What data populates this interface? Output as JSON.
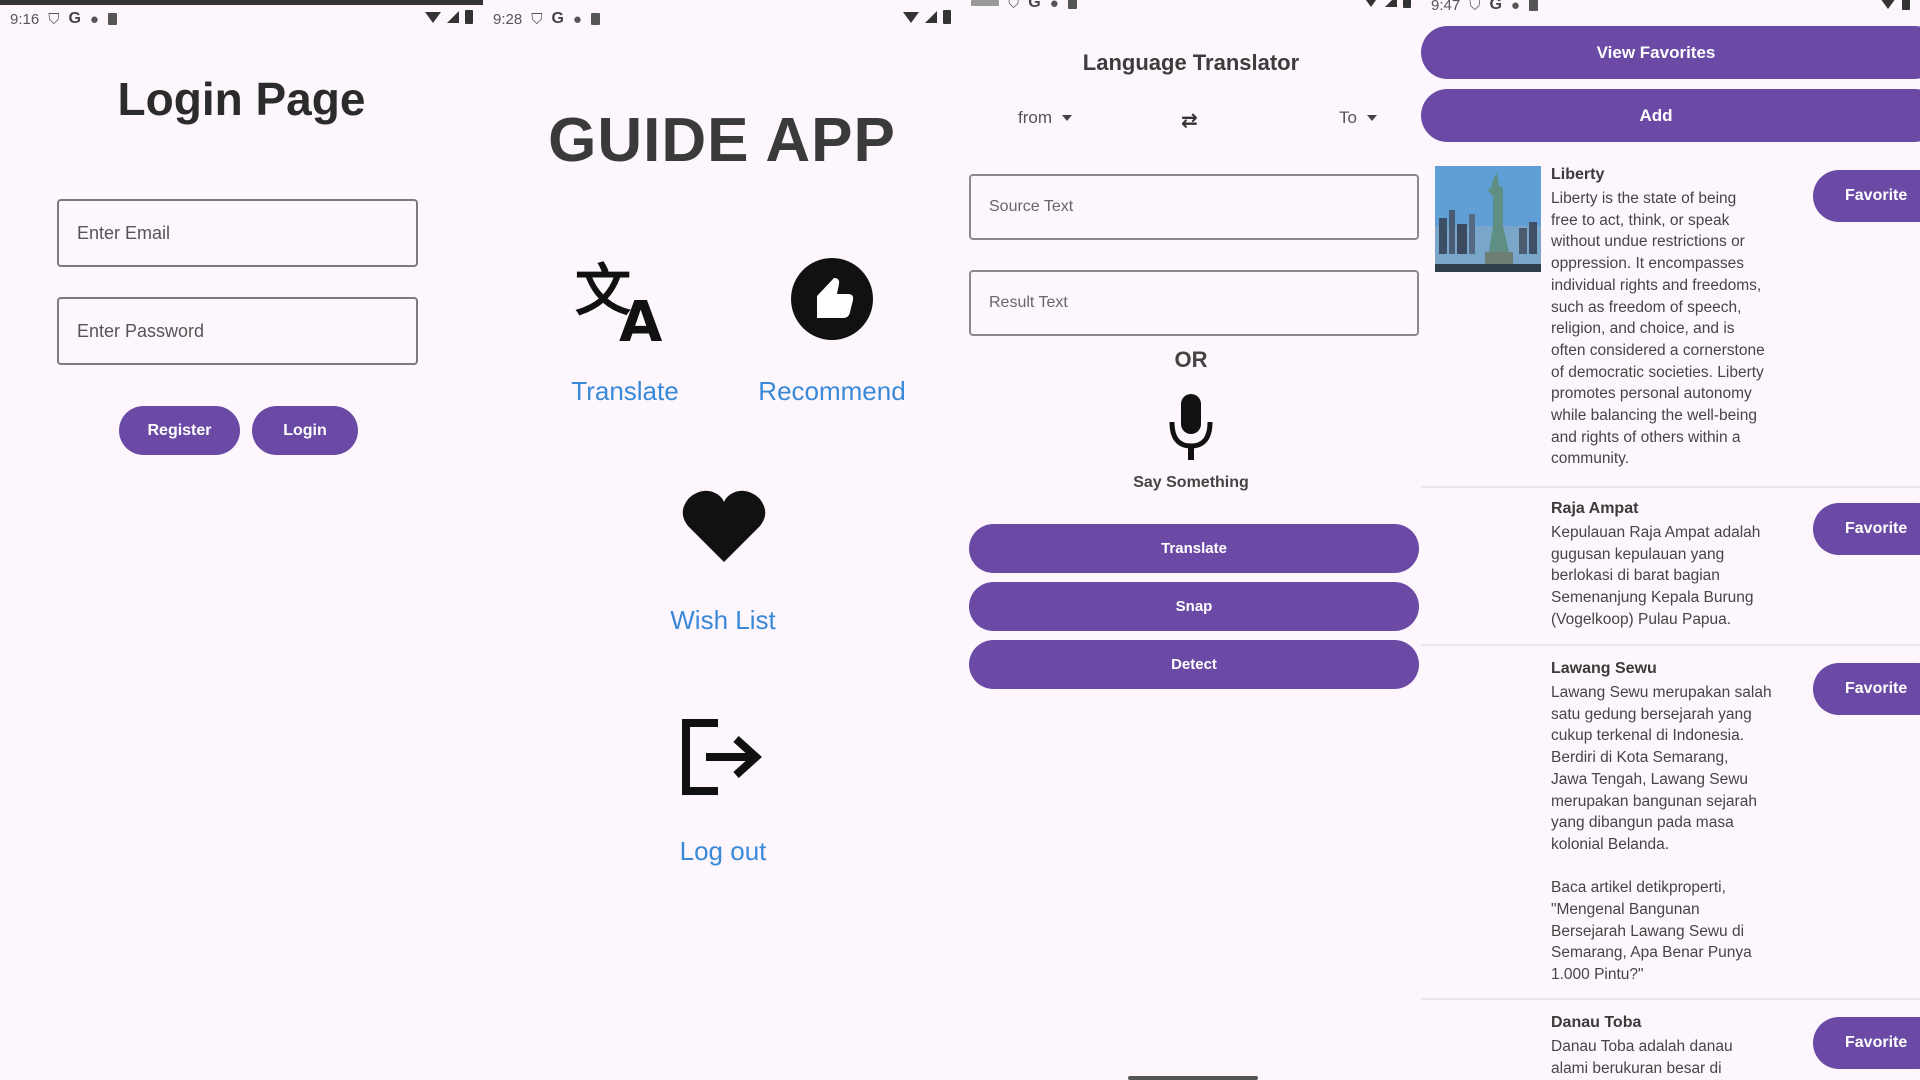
{
  "screens": {
    "login": {
      "status": {
        "time": "9:16"
      },
      "title": "Login Page",
      "email_placeholder": "Enter Email",
      "password_placeholder": "Enter Password",
      "register_label": "Register",
      "login_label": "Login"
    },
    "guide": {
      "status": {
        "time": "9:28"
      },
      "title": "GUIDE APP",
      "menu": {
        "translate": {
          "label": "Translate",
          "icon": "translate-icon"
        },
        "recommend": {
          "label": "Recommend",
          "icon": "thumbs-up-icon"
        },
        "wishlist": {
          "label": "Wish List",
          "icon": "heart-icon"
        },
        "logout": {
          "label": "Log out",
          "icon": "logout-icon"
        }
      }
    },
    "translator": {
      "title": "Language Translator",
      "from_label": "from",
      "to_label": "To",
      "source_placeholder": "Source Text",
      "result_placeholder": "Result Text",
      "or_label": "OR",
      "say_label": "Say Something",
      "translate_label": "Translate",
      "snap_label": "Snap",
      "detect_label": "Detect"
    },
    "favorites": {
      "status": {
        "time": "9:47"
      },
      "view_favorites_label": "View Favorites",
      "add_label": "Add",
      "items": [
        {
          "title": "Liberty",
          "desc": "Liberty is the state of being\nfree to act, think, or speak\nwithout undue restrictions or\noppression. It encompasses\nindividual rights and freedoms,\nsuch as freedom of speech,\nreligion, and choice, and is\noften considered a cornerstone\nof democratic societies. Liberty\npromotes personal autonomy\nwhile balancing the well-being\nand rights of others within a\ncommunity.",
          "favorite_label": "Favorite"
        },
        {
          "title": "Raja Ampat",
          "desc": "Kepulauan Raja Ampat adalah\ngugusan kepulauan yang\nberlokasi di barat bagian\nSemenanjung Kepala Burung\n(Vogelkoop) Pulau Papua.",
          "favorite_label": "Favorite"
        },
        {
          "title": "Lawang Sewu",
          "desc": "Lawang Sewu merupakan salah\nsatu gedung bersejarah yang\ncukup terkenal di Indonesia.\nBerdiri di Kota Semarang,\nJawa Tengah, Lawang Sewu\nmerupakan bangunan sejarah\nyang dibangun pada masa\nkolonial Belanda.\n\nBaca artikel detikproperti,\n\"Mengenal Bangunan\nBersejarah Lawang Sewu di\nSemarang, Apa Benar Punya\n1.000 Pintu?\"",
          "favorite_label": "Favorite"
        },
        {
          "title": "Danau Toba",
          "desc": "Danau Toba adalah danau\nalami berukuran besar di",
          "favorite_label": "Favorite"
        }
      ]
    }
  },
  "colors": {
    "primary": "#6a4aa5",
    "background": "#fdf7fd",
    "link": "#3a88d8"
  }
}
